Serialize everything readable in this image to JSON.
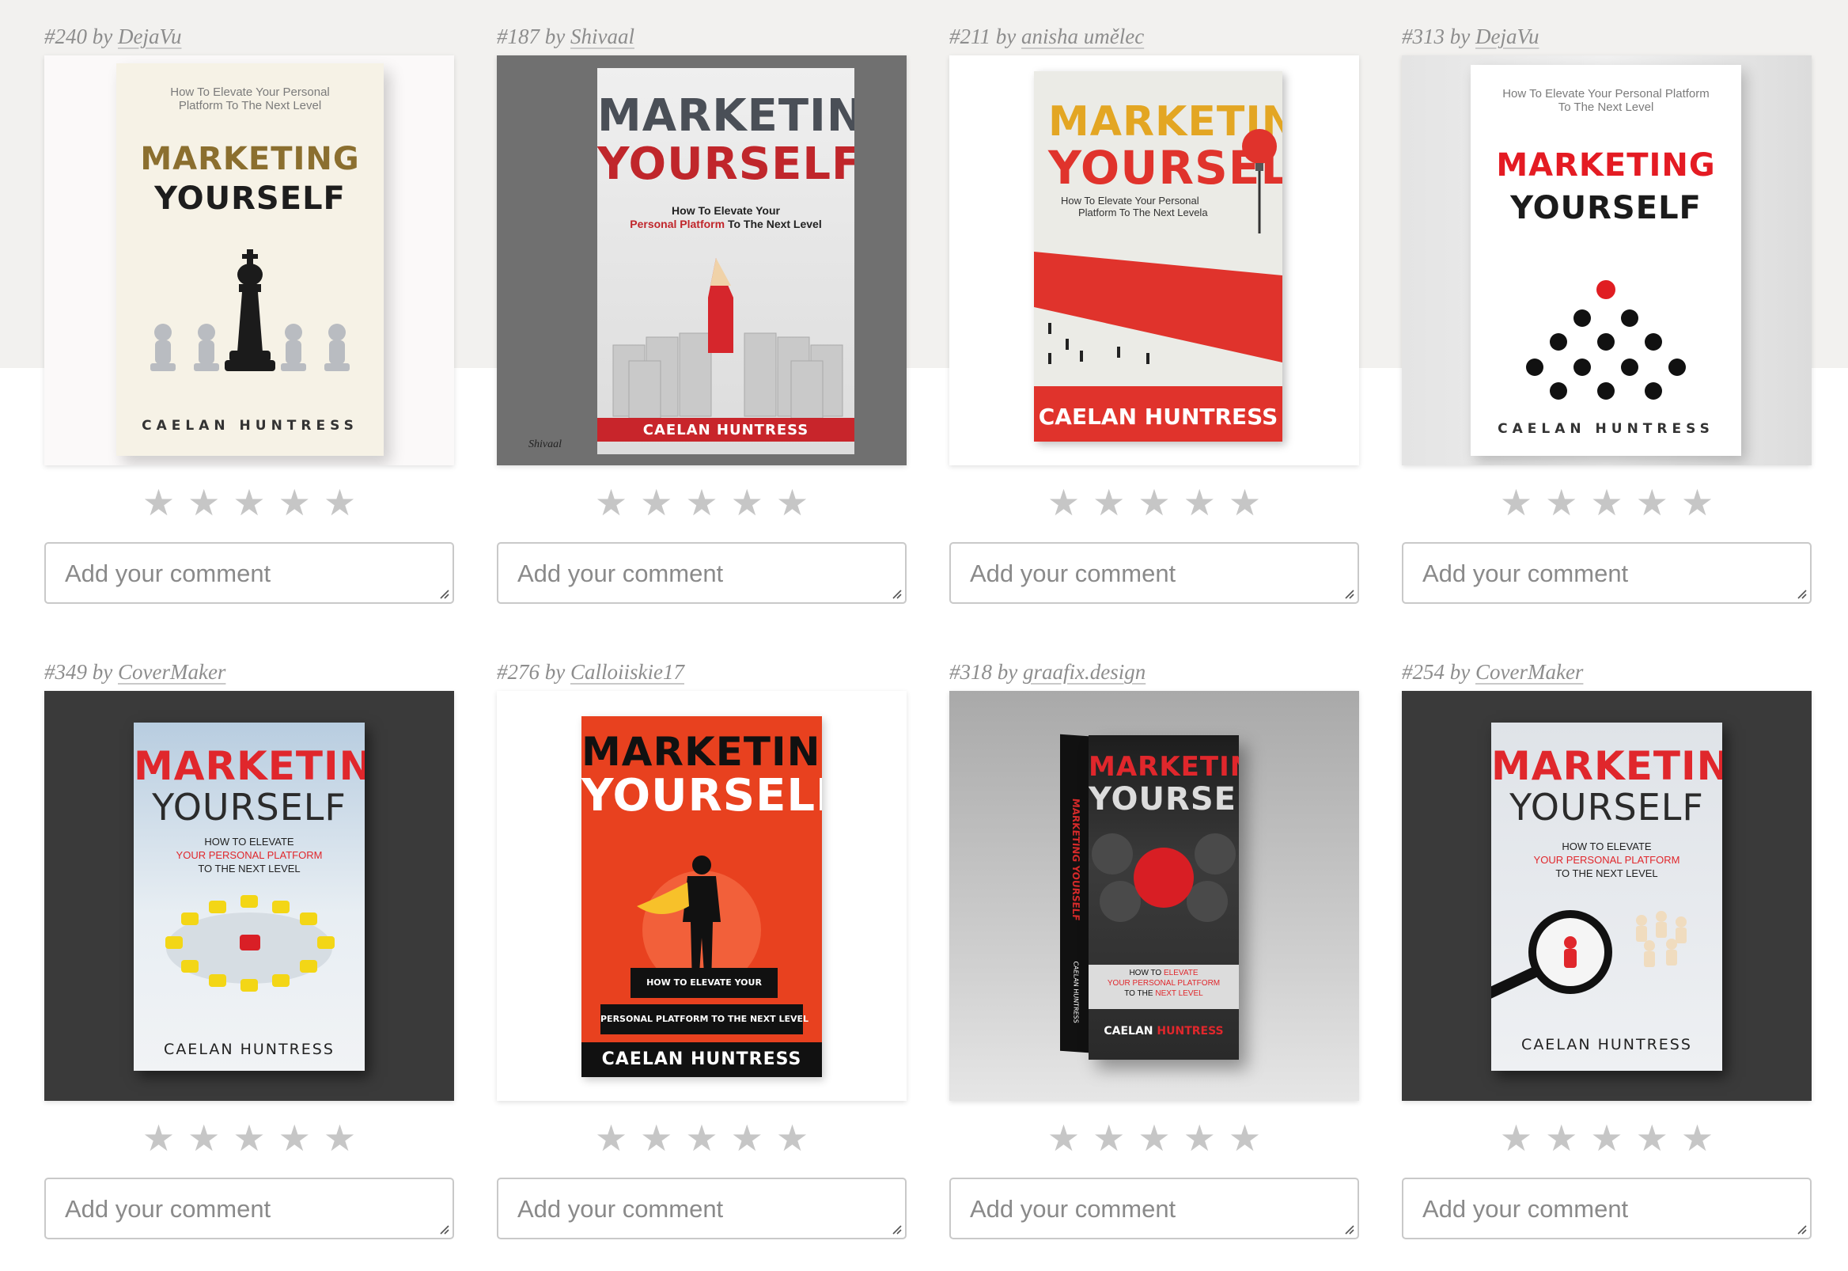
{
  "comment_placeholder": "Add your comment",
  "entries": [
    {
      "number": "#240",
      "by": "by",
      "author": "DejaVu",
      "cover": {
        "subtitle": "How To Elevate Your Personal Platform To The Next Level",
        "title_1": "MARKETING",
        "title_2": "YOURSELF",
        "author": "CAELAN HUNTRESS"
      }
    },
    {
      "number": "#187",
      "by": "by",
      "author": "Shivaal",
      "cover": {
        "title_1": "MARKETING",
        "title_2": "YOURSELF",
        "subtitle_a": "How To Elevate Your",
        "subtitle_b1": "Personal Platform",
        "subtitle_b2": "To The Next Level",
        "author": "CAELAN HUNTRESS",
        "signature": "Shivaal"
      }
    },
    {
      "number": "#211",
      "by": "by",
      "author": "anisha umělec",
      "cover": {
        "title_1": "MARKETING",
        "title_2": "YOURSELF",
        "subtitle_a": "How To Elevate Your Personal",
        "subtitle_b": "Platform To The Next Levela",
        "author": "CAELAN HUNTRESS"
      }
    },
    {
      "number": "#313",
      "by": "by",
      "author": "DejaVu",
      "cover": {
        "subtitle": "How To Elevate Your Personal Platform To The Next Level",
        "title_1": "MARKETING",
        "title_2": "YOURSELF",
        "author": "CAELAN HUNTRESS"
      }
    },
    {
      "number": "#349",
      "by": "by",
      "author": "CoverMaker",
      "cover": {
        "title_1": "MARKETING",
        "title_2": "YOURSELF",
        "subtitle_a": "HOW TO ELEVATE",
        "subtitle_b": "YOUR PERSONAL PLATFORM",
        "subtitle_c": "TO THE NEXT LEVEL",
        "author": "CAELAN HUNTRESS"
      }
    },
    {
      "number": "#276",
      "by": "by",
      "author": "Calloiiskie17",
      "cover": {
        "title_1": "MARKETING",
        "title_2": "YOURSELF",
        "subtitle_a": "HOW TO ELEVATE YOUR",
        "subtitle_b": "PERSONAL PLATFORM TO THE NEXT LEVEL",
        "author": "CAELAN HUNTRESS"
      }
    },
    {
      "number": "#318",
      "by": "by",
      "author": "graafix.design",
      "cover": {
        "title_1": "MARKETING",
        "title_2": "YOURSELF",
        "subtitle_a": "HOW TO",
        "subtitle_a2": "ELEVATE",
        "subtitle_b": "YOUR PERSONAL PLATFORM",
        "subtitle_c1": "TO THE",
        "subtitle_c2": "NEXT LEVEL",
        "author_1": "CAELAN",
        "author_2": "HUNTRESS",
        "spine": "MARKETING YOURSELF",
        "spine_author": "CAELAN HUNTRESS"
      }
    },
    {
      "number": "#254",
      "by": "by",
      "author": "CoverMaker",
      "cover": {
        "title_1": "MARKETING",
        "title_2": "YOURSELF",
        "subtitle_a": "HOW TO ELEVATE",
        "subtitle_b": "YOUR PERSONAL PLATFORM",
        "subtitle_c": "TO THE NEXT LEVEL",
        "author": "CAELAN HUNTRESS"
      }
    }
  ],
  "colors": {
    "star": "#c6c6c6",
    "accent_red": "#d62a27",
    "gold": "#8b6f2f"
  },
  "icons": {
    "star": "star-icon",
    "resize": "resize-handle-icon"
  }
}
